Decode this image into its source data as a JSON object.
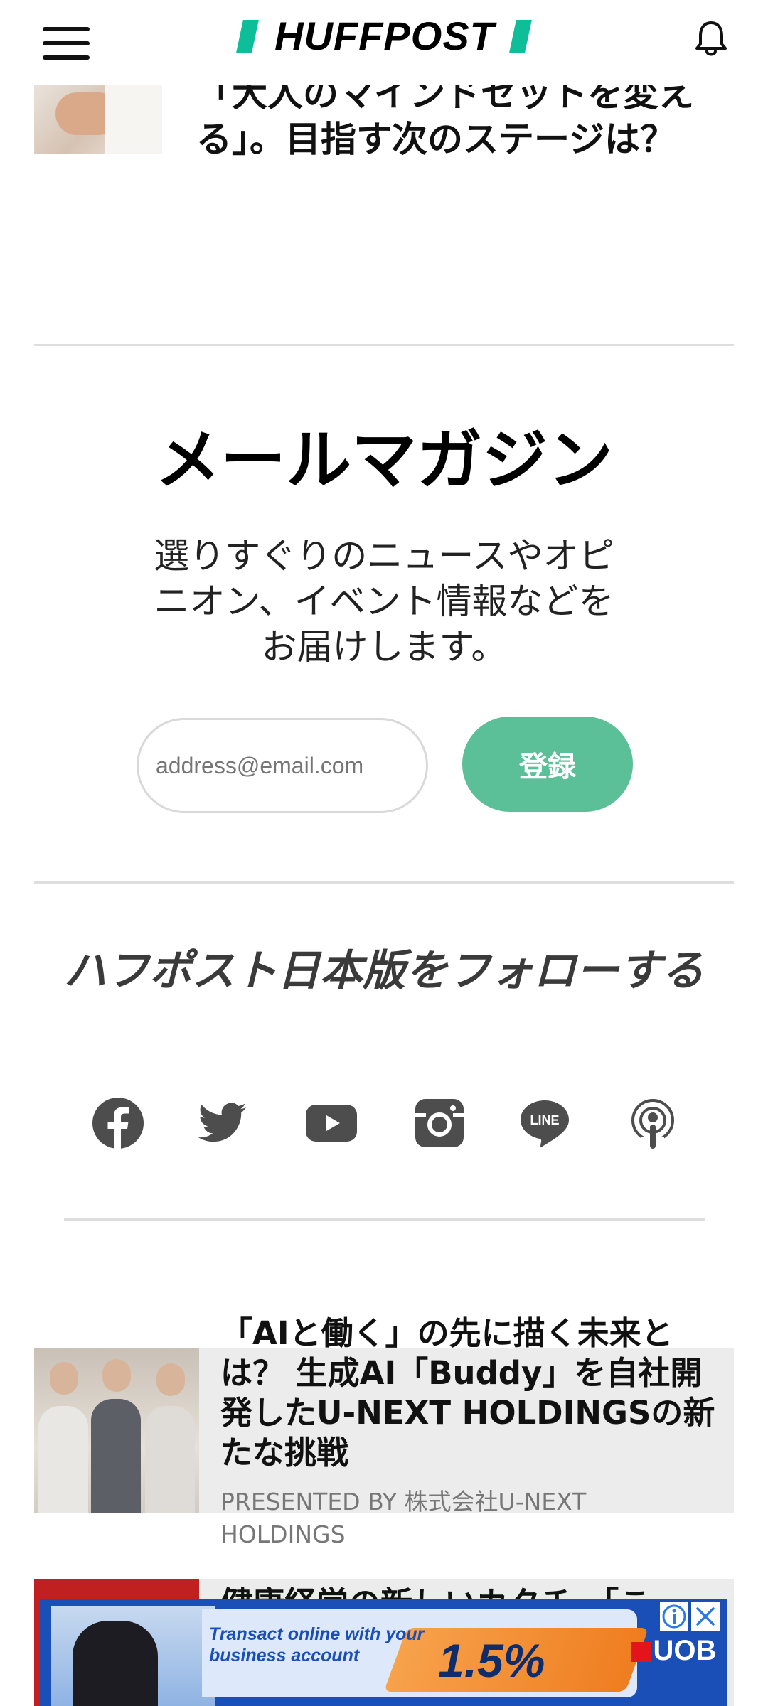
{
  "header": {
    "logo_text": "HUFFPOST",
    "brand_color": "#0dbe98"
  },
  "top_article": {
    "title": "「大人のマインドセットを変える」。目指す次のステージは？"
  },
  "newsletter": {
    "title": "メールマガジン",
    "description": "選りすぐりのニュースやオピニオン、イベント情報などをお届けします。",
    "email_placeholder": "address@email.com",
    "subscribe_label": "登録",
    "button_color": "#5bbf98"
  },
  "follow": {
    "title": "ハフポスト日本版をフォローする",
    "icons": [
      "facebook-icon",
      "twitter-icon",
      "youtube-icon",
      "instagram-icon",
      "line-icon",
      "podcast-icon"
    ],
    "line_label": "LINE"
  },
  "sponsored": {
    "title": "「AIと働く」の先に描く未来とは？ 生成AI「Buddy」を自社開発したU-NEXT HOLDINGSの新たな挑戦",
    "presented_by": "PRESENTED BY 株式会社U-NEXT HOLDINGS"
  },
  "next_article": {
    "title": "健康経営の新しいカタチ。「こ"
  },
  "ad": {
    "message": "Transact online with your business account",
    "rate": "1.5%",
    "brand": "UOB",
    "info_icon": "info-icon",
    "close_icon": "close-icon"
  }
}
